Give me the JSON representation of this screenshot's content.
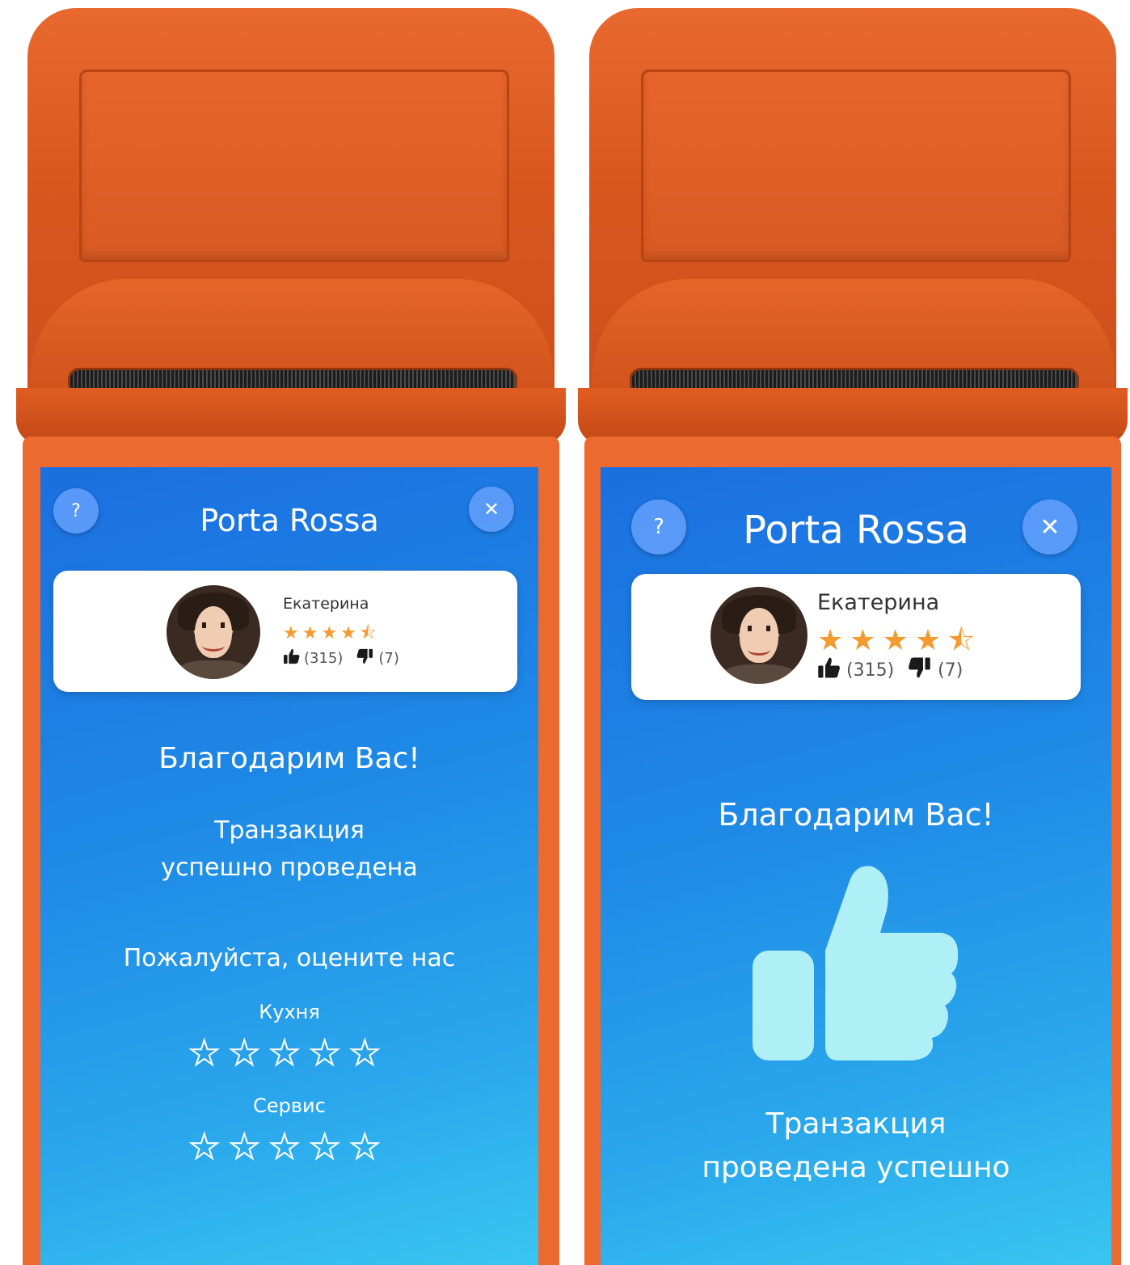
{
  "left_screen": {
    "help_label": "?",
    "close_label": "✕",
    "title": "Porta Rossa",
    "waiter": {
      "name": "Екатерина",
      "stars": "★★★★⯪",
      "likes": "(315)",
      "dislikes": "(7)"
    },
    "thanks": "Благодарим Вас!",
    "transaction_line1": "Транзакция",
    "transaction_line2": "успешно проведена",
    "rate_prompt": "Пожалуйста, оцените нас",
    "kitchen_label": "Кухня",
    "service_label": "Сервис",
    "kitchen_rating": 0,
    "service_rating": 0,
    "max_rating": 5
  },
  "right_screen": {
    "help_label": "?",
    "close_label": "✕",
    "title": "Porta Rossa",
    "waiter": {
      "name": "Екатерина",
      "stars": "★★★★⯪",
      "likes": "(315)",
      "dislikes": "(7)"
    },
    "thanks": "Благодарим Вас!",
    "transaction_line1": "Транзакция",
    "transaction_line2": "проведена успешно"
  },
  "icons": {
    "help": "question-icon",
    "close": "close-icon",
    "like": "thumbs-up-icon",
    "dislike": "thumbs-down-icon",
    "big_like": "thumbs-up-large-icon",
    "empty_star": "star-outline-icon"
  },
  "colors": {
    "device_orange": "#e8692f",
    "screen_blue_top": "#1b6fe0",
    "screen_blue_bottom": "#39c7f0",
    "star_orange": "#f59a2e",
    "big_thumb": "#aef0f5"
  }
}
